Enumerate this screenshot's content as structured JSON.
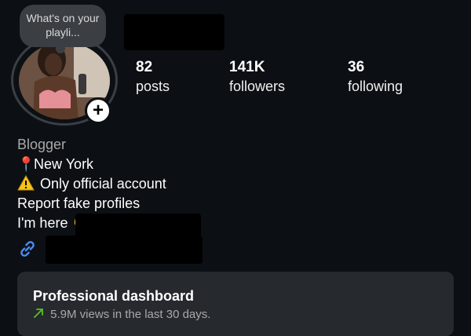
{
  "note": {
    "text": "What's on your playli..."
  },
  "stats": [
    {
      "value": "82",
      "label": "posts"
    },
    {
      "value": "141K",
      "label": "followers"
    },
    {
      "value": "36",
      "label": "following"
    }
  ],
  "bio": {
    "category": "Blogger",
    "lines": [
      "New York",
      "Only official account",
      "Report fake profiles",
      "I'm here"
    ],
    "pin_emoji": "📍",
    "warning_emoji": "⚠",
    "hand_emoji": "👇"
  },
  "dashboard": {
    "title": "Professional dashboard",
    "subtitle": "5.9M views in the last 30 days."
  },
  "colors": {
    "background": "#0c1014",
    "card": "#262a2f",
    "accent_link": "#4b8df8",
    "trend_green": "#58c322"
  }
}
